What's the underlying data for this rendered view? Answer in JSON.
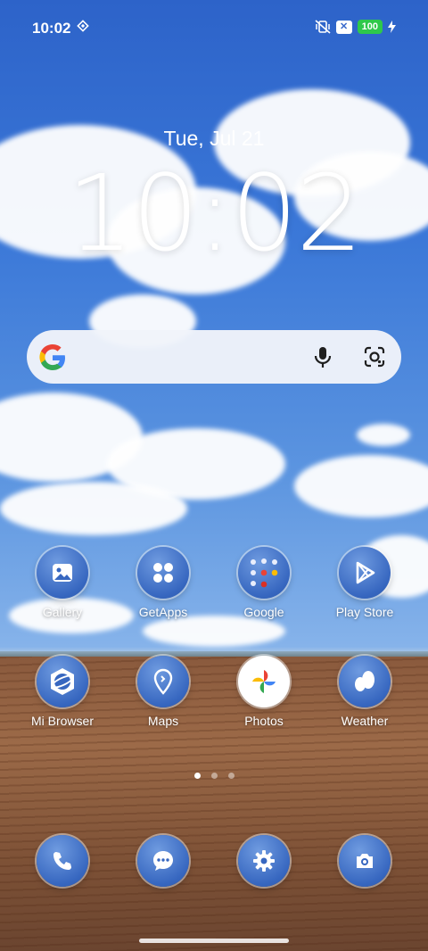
{
  "status": {
    "time": "10:02",
    "battery": "100",
    "icons": [
      "vibrate-off-icon",
      "close-badge-icon",
      "charging-icon"
    ]
  },
  "lockscreen": {
    "date": "Tue, Jul 21",
    "clock": "10:02"
  },
  "search": {
    "icons": [
      "google-g-icon",
      "mic-icon",
      "google-lens-icon"
    ]
  },
  "apps_row1": [
    {
      "label": "Gallery",
      "icon": "gallery-icon"
    },
    {
      "label": "GetApps",
      "icon": "getapps-icon"
    },
    {
      "label": "Google",
      "icon": "google-folder-icon"
    },
    {
      "label": "Play Store",
      "icon": "play-store-icon"
    }
  ],
  "apps_row2": [
    {
      "label": "Mi Browser",
      "icon": "browser-icon"
    },
    {
      "label": "Maps",
      "icon": "maps-icon"
    },
    {
      "label": "Photos",
      "icon": "photos-icon"
    },
    {
      "label": "Weather",
      "icon": "weather-icon"
    }
  ],
  "dock": [
    {
      "icon": "phone-icon"
    },
    {
      "icon": "messages-icon"
    },
    {
      "icon": "settings-icon"
    },
    {
      "icon": "camera-icon"
    }
  ],
  "page_indicator": {
    "pages": 3,
    "active": 1
  },
  "colors": {
    "accent": "#3767c0",
    "battery": "#2ec84b"
  }
}
